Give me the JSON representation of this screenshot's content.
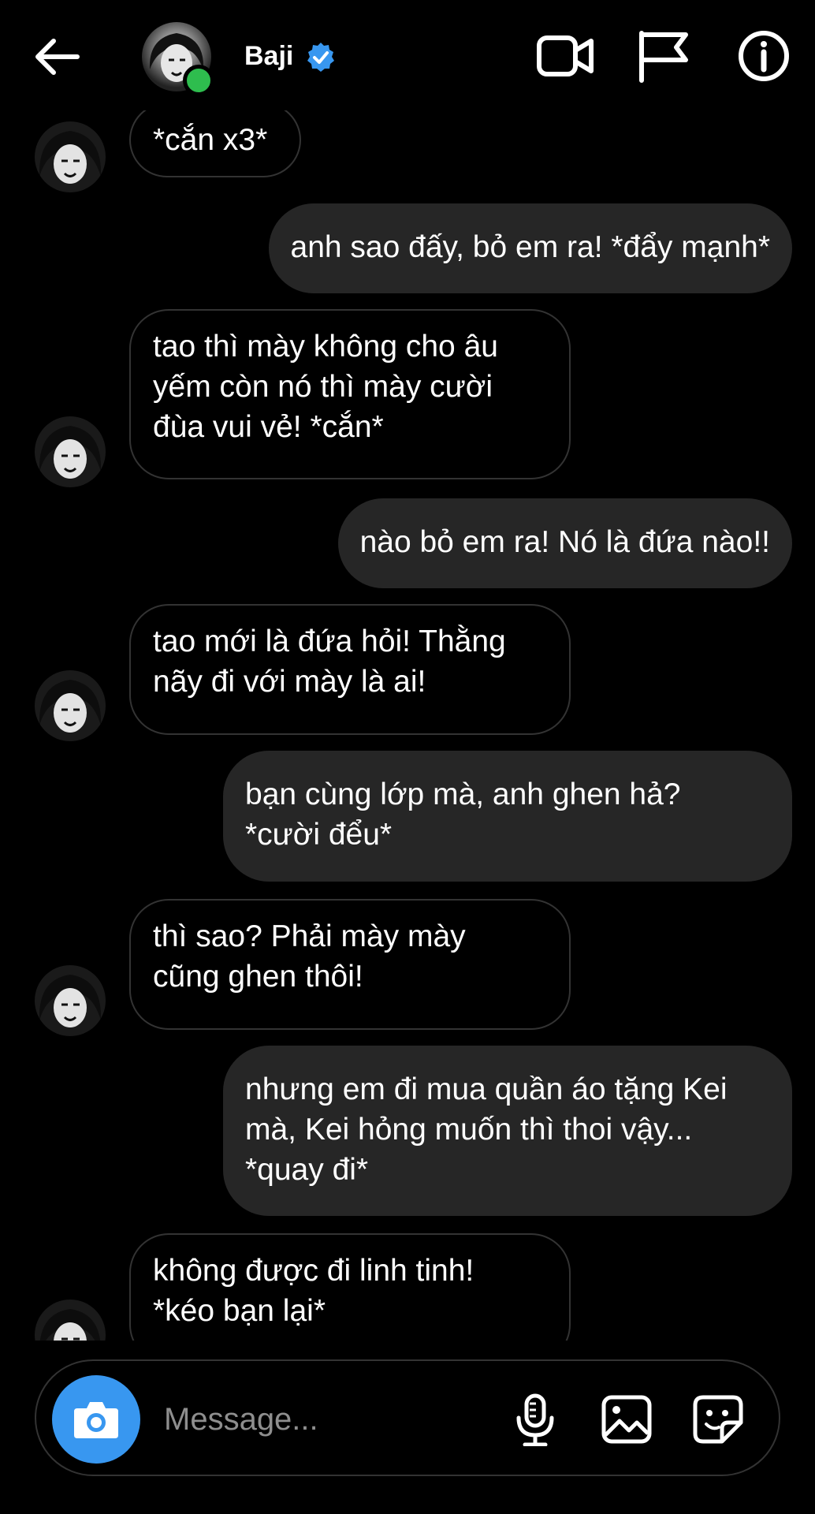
{
  "header": {
    "name": "Baji",
    "verified": true,
    "online": true,
    "icons": [
      "back-arrow-icon",
      "video-call-icon",
      "flag-icon",
      "info-icon"
    ]
  },
  "colors": {
    "background": "#000000",
    "outgoing_bubble": "#262626",
    "incoming_border": "#333333",
    "accent": "#3897f0",
    "online": "#2ebd4e"
  },
  "messages": [
    {
      "dir": "in",
      "text": "*cắn x3*"
    },
    {
      "dir": "out",
      "text": "anh sao đấy, bỏ em ra! *đẩy mạnh*"
    },
    {
      "dir": "in",
      "text": "tao thì mày không cho âu\nyếm còn nó thì mày cười\nđùa vui vẻ! *cắn*"
    },
    {
      "dir": "out",
      "text": "nào bỏ em ra! Nó là đứa nào!!"
    },
    {
      "dir": "in",
      "text": "tao mới là đứa hỏi! Thằng\nnãy đi với mày là ai!"
    },
    {
      "dir": "out",
      "text": "bạn cùng lớp mà, anh ghen hả?\n*cười đểu*"
    },
    {
      "dir": "in",
      "text": "thì sao? Phải mày mày\ncũng ghen thôi!"
    },
    {
      "dir": "out",
      "text": "nhưng em đi mua quần áo tặng Kei\nmà, Kei hỏng muốn thì thoi vậy...\n*quay đi*"
    },
    {
      "dir": "in",
      "text": "không được đi linh tinh!\n*kéo bạn lại*"
    }
  ],
  "composer": {
    "placeholder": "Message...",
    "icons": [
      "camera-icon",
      "microphone-icon",
      "gallery-icon",
      "sticker-icon"
    ]
  }
}
